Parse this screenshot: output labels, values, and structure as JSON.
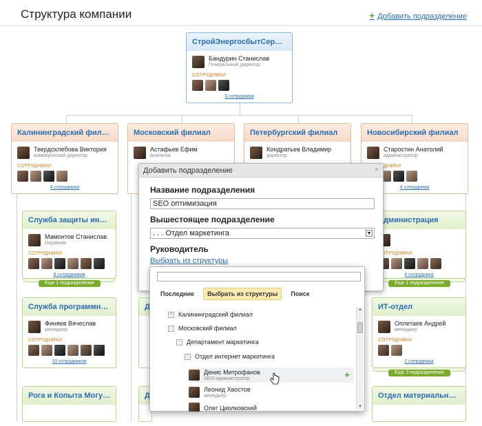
{
  "header": {
    "title": "Структура компании",
    "add_label": "Добавить подразделение"
  },
  "root": {
    "title": "СтройЭнергосбытСервис",
    "person": "Бандурин Станислав",
    "role": "Генеральный директор",
    "staff_label": "СОТРУДНИКИ",
    "count": "3 сотрудника"
  },
  "branches": [
    {
      "title": "Калининградский филиал",
      "person": "Твердохлебова Виктория",
      "role": "коммерческий директор",
      "staff_label": "СОТРУДНИКИ",
      "count": "4 сотрудника"
    },
    {
      "title": "Московский филиал",
      "person": "Астафьев Ефим",
      "role": "аналитик"
    },
    {
      "title": "Петербургский филиал",
      "person": "Кондратьев Владимир",
      "role": "директор"
    },
    {
      "title": "Новосибирский филиал",
      "person": "Старостин Анатолий",
      "role": "администратор",
      "staff_label": "СОТРУДНИКИ",
      "count": "4 сотрудника"
    }
  ],
  "departments_left": [
    {
      "title": "Служба защиты инфо...",
      "person": "Мамонтов Станислав",
      "role": "Охранник",
      "staff_label": "СОТРУДНИКИ",
      "count": "8 сотрудников",
      "more": "Еще 1 подразделение"
    },
    {
      "title": "Служба программной...",
      "person": "Финяев Вячеслав",
      "role": "менеджер",
      "staff_label": "СОТРУДНИКИ",
      "count": "10 сотрудников"
    },
    {
      "title": "Рога и Копыта Могуче..."
    }
  ],
  "departments_right": [
    {
      "title": "Администрация",
      "staff_label": "СОТРУДНИКИ",
      "count": "4 сотрудника",
      "more": "Еще 1 подразделение"
    },
    {
      "title": "ИТ-отдел",
      "person": "Оплетаев Андрей",
      "role": "менеджер",
      "staff_label": "СОТРУДНИКИ",
      "count": "2 сотрудника",
      "more": "Еще 3 подразделения"
    },
    {
      "title": "Отдел материально-те..."
    }
  ],
  "middle_stub": "Д",
  "dialog": {
    "title": "Добавить подразделение",
    "close": "×",
    "name_label": "Название подразделения",
    "name_value": "SEO оптимизация",
    "parent_label": "Вышестоящее подразделение",
    "parent_value": ". . . Отдел маркетинга",
    "head_label": "Руководитель",
    "pick_link": "Выбрать из структуры"
  },
  "popup": {
    "tabs": [
      "Последние",
      "Выбрать из структуры",
      "Поиск"
    ],
    "tree": [
      {
        "label": "Калининградский филиал",
        "toggle": "+"
      },
      {
        "label": "Московский филиал",
        "toggle": "-"
      },
      {
        "label": "Департамент маркетинга",
        "toggle": "-"
      },
      {
        "label": "Отдел интернет маркетинга",
        "toggle": "-"
      }
    ],
    "people": [
      {
        "name": "Денис Митрофанов",
        "role": "SEO-администратор"
      },
      {
        "name": "Леонид Хвостов",
        "role": "менеджер"
      },
      {
        "name": "Олег Циолковский",
        "role": ""
      }
    ],
    "add_glyph": "+"
  }
}
